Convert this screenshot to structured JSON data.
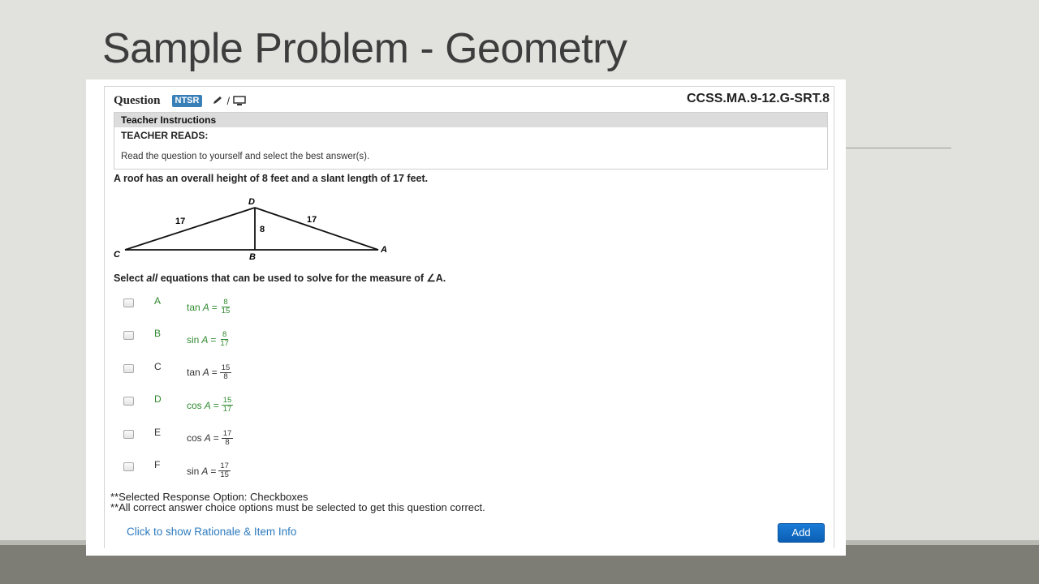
{
  "slide": {
    "title": "Sample Problem - Geometry"
  },
  "question": {
    "label": "Question",
    "badge": "NTSR",
    "mode_separator": "/",
    "standard": "CCSS.MA.9-12.G-SRT.8"
  },
  "teacher_instructions": {
    "heading": "Teacher Instructions",
    "reads": "TEACHER READS:",
    "text": "Read the question to yourself and select the best answer(s)."
  },
  "stem": "A roof has an overall height of 8 feet and a slant length of 17 feet.",
  "diagram": {
    "labels": {
      "D": "D",
      "C": "C",
      "B": "B",
      "A": "A"
    },
    "left_slant": "17",
    "right_slant": "17",
    "height": "8"
  },
  "prompt": {
    "pre": "Select ",
    "emph": "all",
    "post": " equations that can be used to solve for the measure of ∠A."
  },
  "options": [
    {
      "letter": "A",
      "fn": "tan",
      "var": "A",
      "eq": "=",
      "num": "8",
      "den": "15",
      "correct": true
    },
    {
      "letter": "B",
      "fn": "sin",
      "var": "A",
      "eq": "=",
      "num": "8",
      "den": "17",
      "correct": true
    },
    {
      "letter": "C",
      "fn": "tan",
      "var": "A",
      "eq": "=",
      "num": "15",
      "den": "8",
      "correct": false
    },
    {
      "letter": "D",
      "fn": "cos",
      "var": "A",
      "eq": "=",
      "num": "15",
      "den": "17",
      "correct": true
    },
    {
      "letter": "E",
      "fn": "cos",
      "var": "A",
      "eq": "=",
      "num": "17",
      "den": "8",
      "correct": false
    },
    {
      "letter": "F",
      "fn": "sin",
      "var": "A",
      "eq": "=",
      "num": "17",
      "den": "15",
      "correct": false
    }
  ],
  "notes": [
    "**Selected Response Option: Checkboxes",
    "**All correct answer choice options must be selected to get this question correct."
  ],
  "footer": {
    "rationale_link": "Click to show Rationale & Item Info",
    "add_button": "Add"
  },
  "colors": {
    "correct_green": "#2f8a2f",
    "link_blue": "#2e7bbf",
    "badge_blue": "#3a80b8",
    "button_blue": "#0b5fb4"
  }
}
